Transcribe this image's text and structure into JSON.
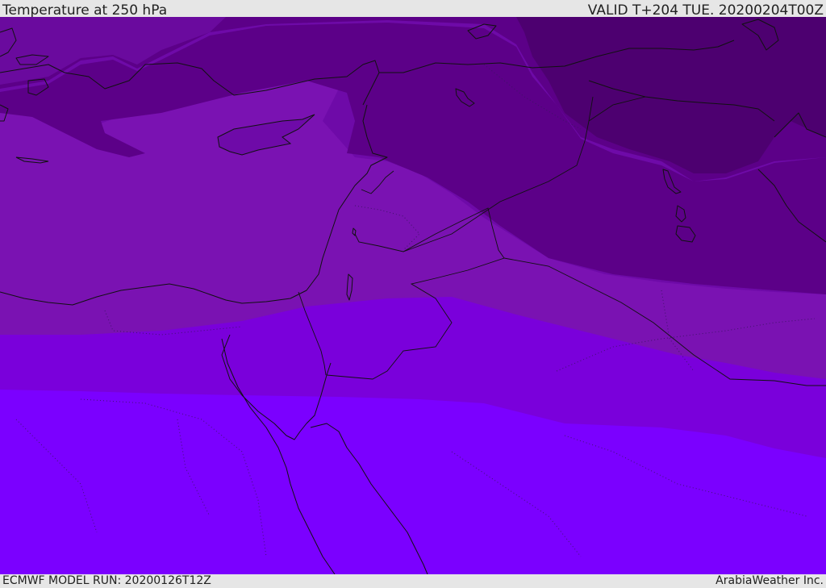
{
  "header": {
    "title": "Temperature at 250 hPa",
    "valid_time": "VALID T+204 TUE. 20200204T00Z"
  },
  "footer": {
    "model_run": "ECMWF MODEL RUN: 20200126T12Z",
    "credit": "ArabiaWeather Inc."
  },
  "map": {
    "colors": {
      "band_darkest": "#4d0070",
      "band_dark": "#5c0088",
      "band_mid": "#6e0aa8",
      "band_light_violet": "#7a12b2",
      "band_violet": "#7a00db",
      "band_bright": "#7b00ff",
      "coastline": "#111111"
    }
  }
}
